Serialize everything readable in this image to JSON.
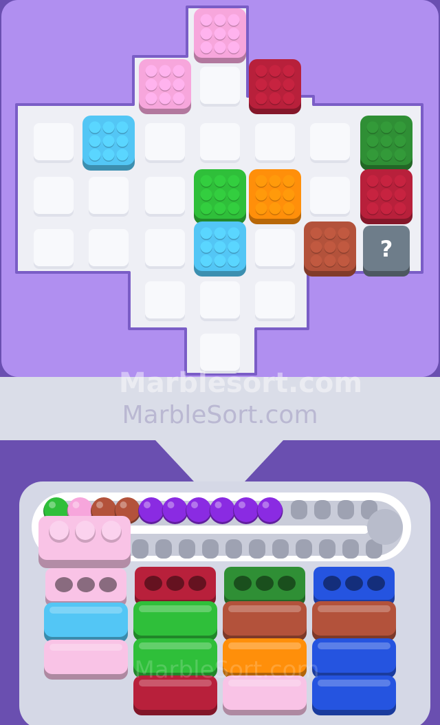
{
  "watermarks": {
    "primary": "Marblesort.com",
    "secondary": "MarbleSort.com",
    "tertiary": "MarbleSort.com"
  },
  "colors": {
    "frame": "#6a4fb0",
    "board_wall": "#b08ff0",
    "board_floor": "#eeeff5",
    "empty_slot": "#f8f9fc",
    "pink": "#f7a6dc",
    "pink_light": "#f9c3e6",
    "blue": "#53c6f5",
    "red": "#b8203b",
    "green": "#2fbf3a",
    "orange": "#ff8f0a",
    "dark_green": "#2f8f35",
    "brown": "#b3523b",
    "purple": "#8a2be2",
    "royal_blue": "#2554e0",
    "mystery": "#6e7d8a"
  },
  "board": {
    "blocks": [
      {
        "color": "pink",
        "row": -2,
        "col": 3
      },
      {
        "color": "pink",
        "row": -1,
        "col": 2
      },
      {
        "color": "red",
        "row": -1,
        "col": 4
      },
      {
        "color": "blue",
        "row": 0,
        "col": 1
      },
      {
        "color": "dark_green",
        "row": 0,
        "col": 6
      },
      {
        "color": "green",
        "row": 1,
        "col": 3
      },
      {
        "color": "orange",
        "row": 1,
        "col": 4
      },
      {
        "color": "red",
        "row": 1,
        "col": 6
      },
      {
        "color": "blue",
        "row": 2,
        "col": 3
      },
      {
        "color": "brown",
        "row": 2,
        "col": 5
      }
    ],
    "mystery_block": {
      "row": 2,
      "col": 6,
      "label": "?",
      "icon": "question-mark-icon"
    }
  },
  "conveyor": {
    "marbles": [
      "green",
      "pink",
      "brown",
      "brown",
      "purple",
      "purple",
      "purple",
      "purple",
      "purple",
      "purple"
    ],
    "empty_slots": 4
  },
  "active_container": {
    "color": "pink_light",
    "balls": 3
  },
  "columns": [
    {
      "top": "pink_light",
      "stack": [
        "pink_light",
        "blue",
        "pink_light"
      ]
    },
    {
      "top": "red",
      "stack": [
        "red",
        "green",
        "green",
        "red"
      ]
    },
    {
      "top": "dark_green",
      "stack": [
        "dark_green",
        "brown",
        "orange",
        "pink_light"
      ]
    },
    {
      "top": "royal_blue",
      "stack": [
        "royal_blue",
        "brown",
        "royal_blue",
        "royal_blue"
      ]
    }
  ]
}
